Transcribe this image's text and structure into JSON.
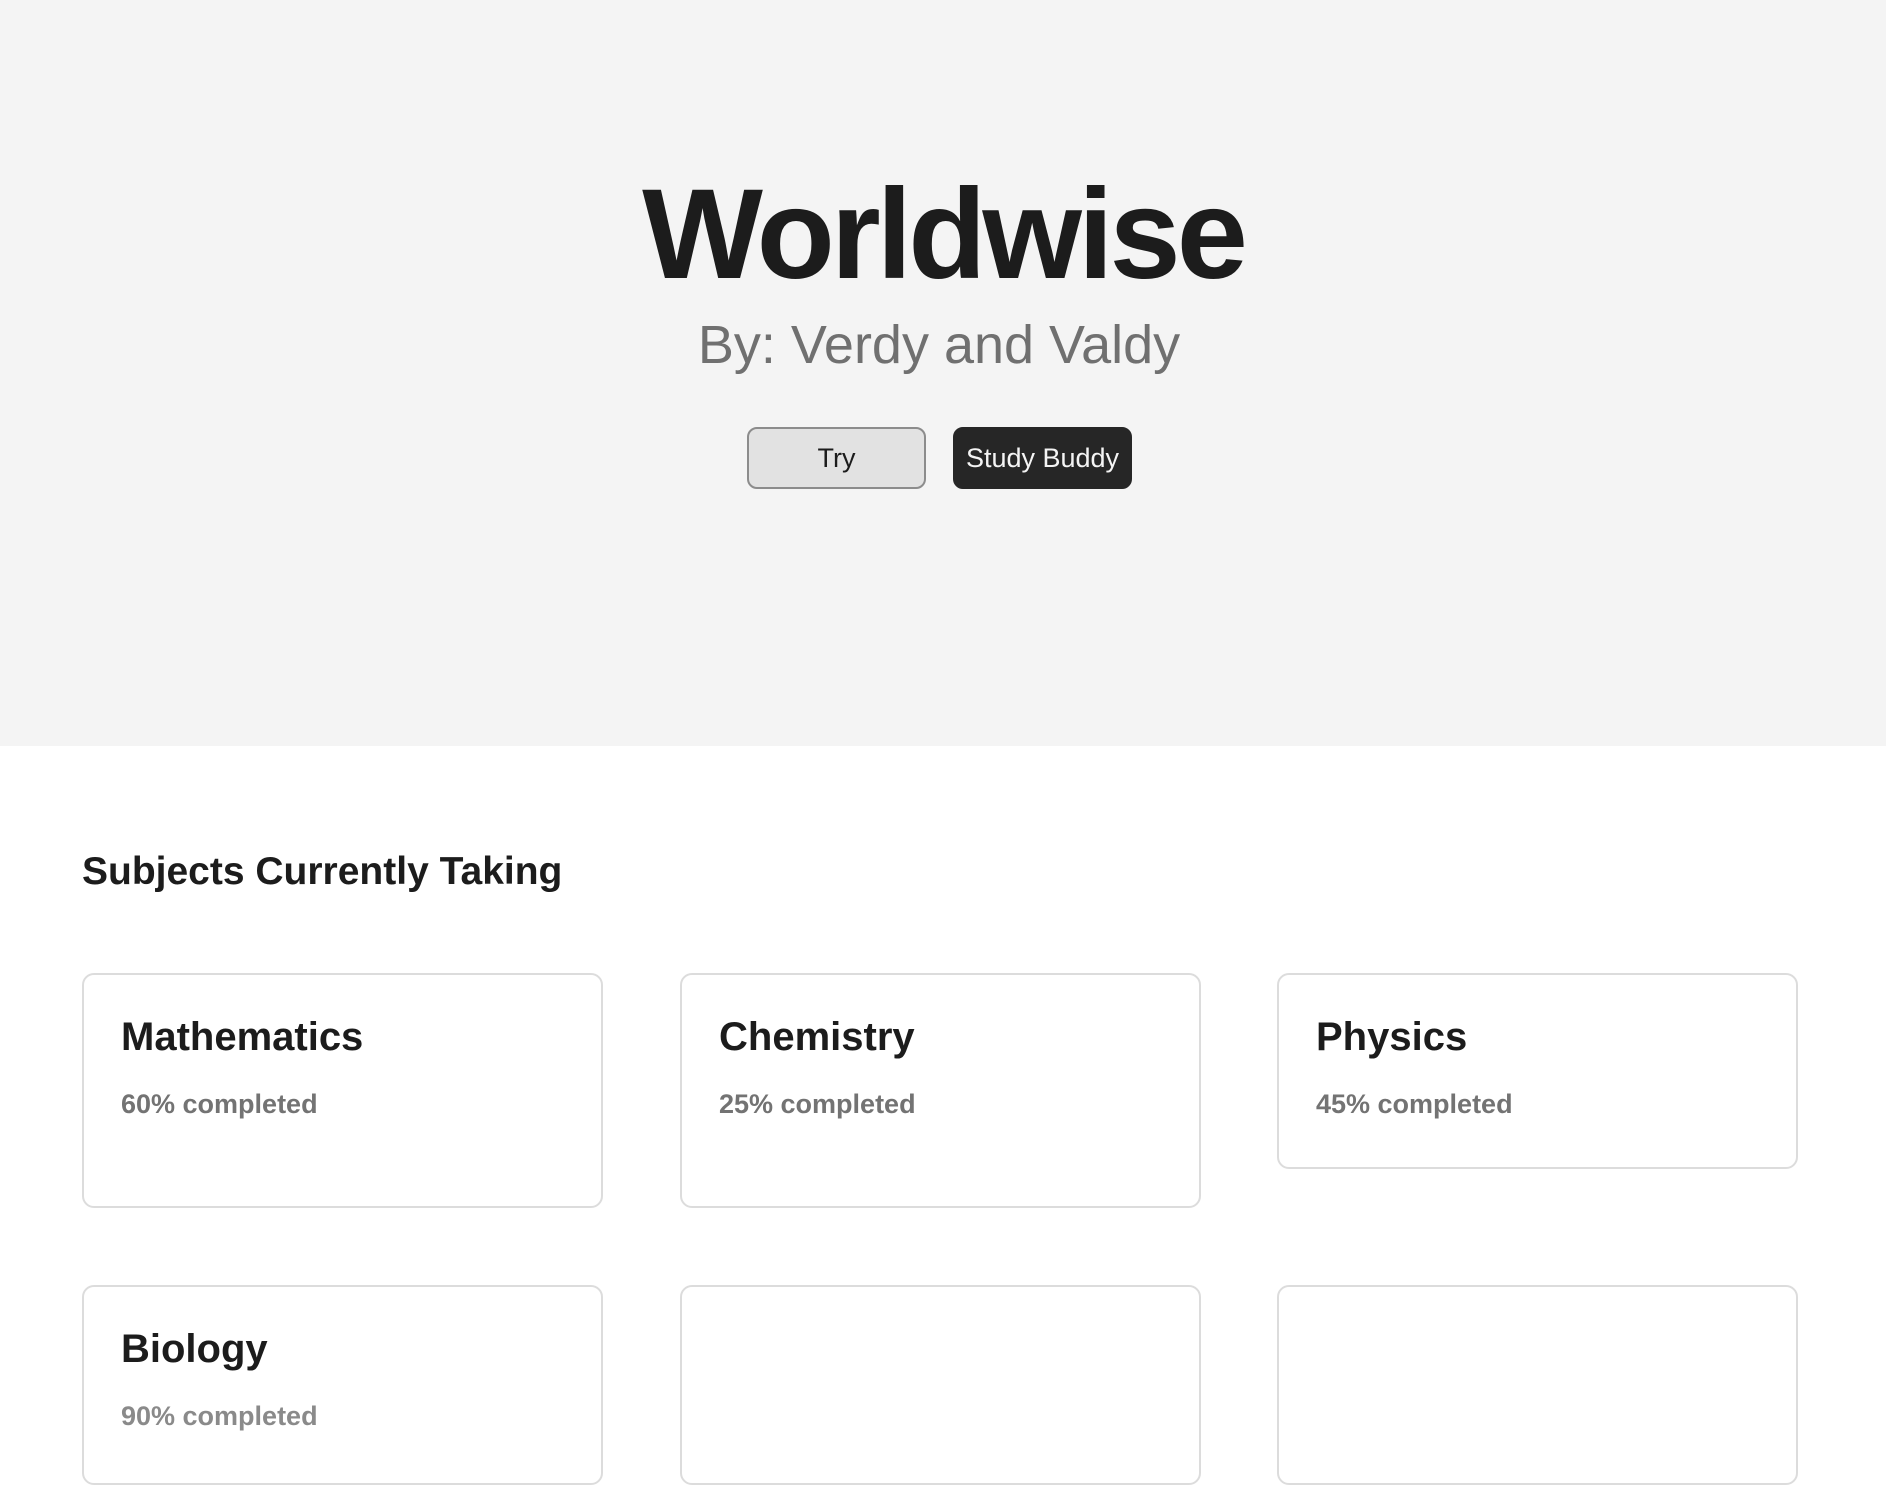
{
  "hero": {
    "title": "Worldwise",
    "subtitle": "By: Verdy and Valdy",
    "buttons": {
      "try_label": "Try",
      "study_buddy_label": "Study Buddy"
    }
  },
  "subjects": {
    "heading": "Subjects Currently Taking",
    "cards": [
      {
        "name": "Mathematics",
        "progress_text": "60% completed",
        "progress_pct": 60
      },
      {
        "name": "Chemistry",
        "progress_text": "25% completed",
        "progress_pct": 25
      },
      {
        "name": "Physics",
        "progress_text": "45% completed",
        "progress_pct": 45
      },
      {
        "name": "Biology",
        "progress_text": "90% completed",
        "progress_pct": 90
      },
      {
        "name": "",
        "progress_text": ""
      },
      {
        "name": "",
        "progress_text": ""
      }
    ]
  },
  "colors": {
    "hero_background": "#f4f4f4",
    "primary_button": "#262626",
    "secondary_button": "#e2e2e2",
    "muted_text": "#737373"
  }
}
